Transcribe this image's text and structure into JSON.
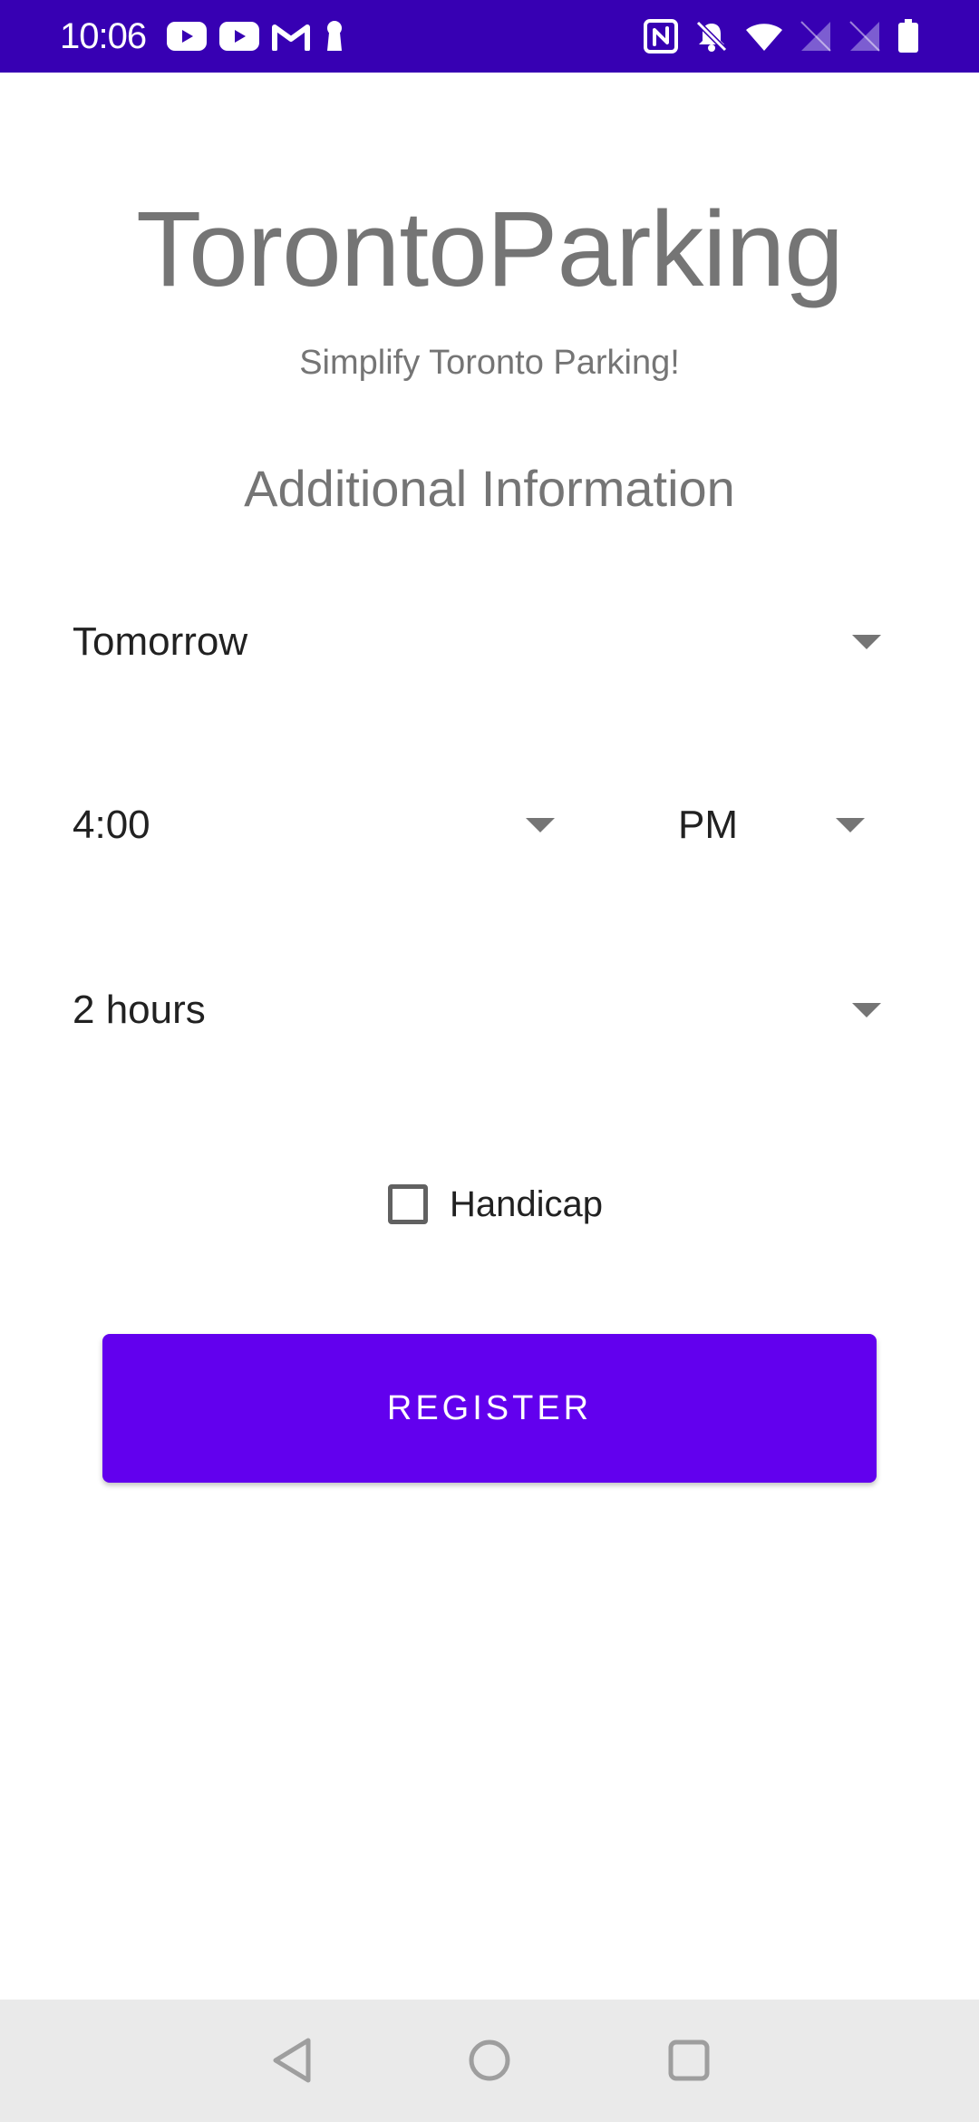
{
  "status_bar": {
    "time": "10:06",
    "background_color": "#3700b3",
    "left_icons": [
      "youtube-icon",
      "youtube-icon",
      "gmail-icon",
      "keyhole-icon"
    ],
    "right_icons": [
      "nfc-icon",
      "notifications-off-icon",
      "wifi-icon",
      "signal-off-icon",
      "signal-off-icon",
      "battery-icon"
    ]
  },
  "app": {
    "title": "TorontoParking",
    "subtitle": "Simplify Toronto Parking!"
  },
  "form": {
    "section_title": "Additional Information",
    "day_spinner": {
      "selected": "Tomorrow"
    },
    "time_spinner": {
      "selected": "4:00"
    },
    "ampm_spinner": {
      "selected": "PM"
    },
    "duration_spinner": {
      "selected": "2 hours"
    },
    "handicap": {
      "label": "Handicap",
      "checked": false
    },
    "register_button": {
      "label": "REGISTER",
      "color": "#6200ee"
    }
  },
  "nav_bar": {
    "icons": [
      "back-icon",
      "home-icon",
      "recents-icon"
    ]
  }
}
